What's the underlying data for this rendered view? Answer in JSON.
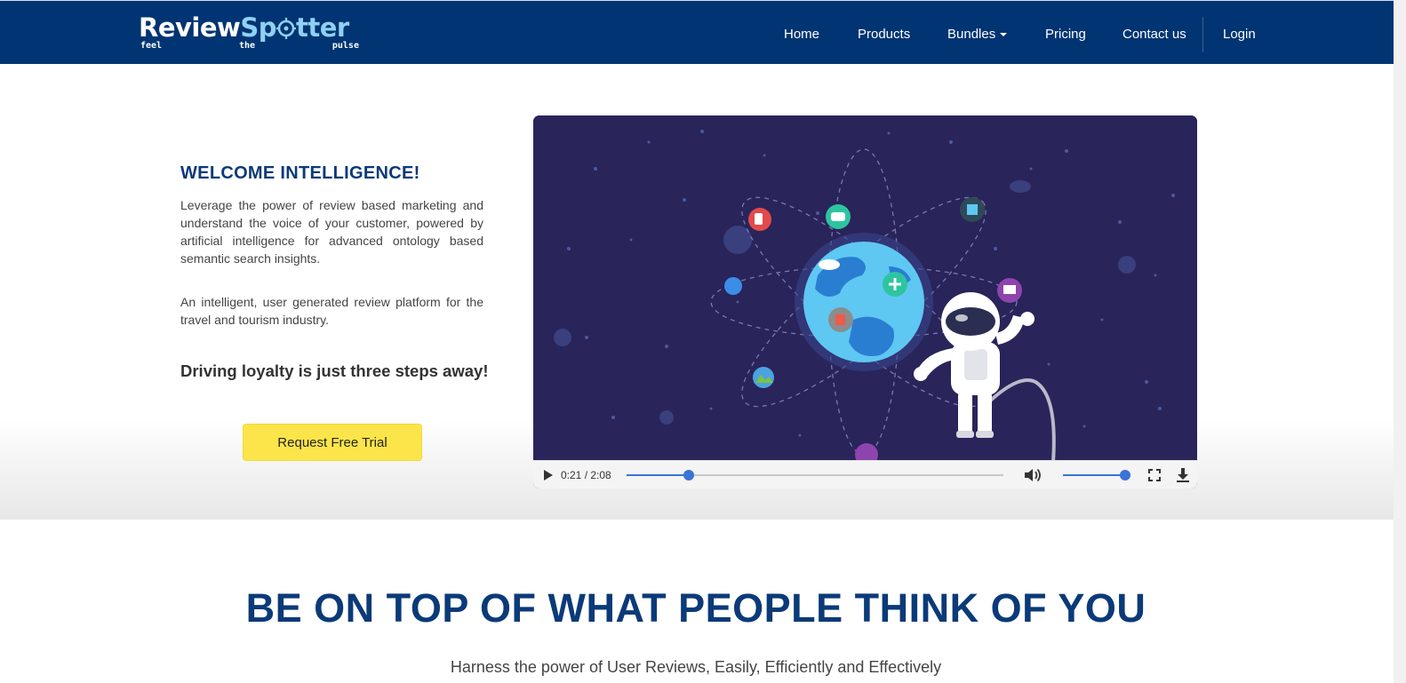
{
  "brand": {
    "name_part1": "Review",
    "name_part2": "Sp",
    "name_part3": "tter",
    "tagline_words": [
      "feel",
      "the",
      "pulse"
    ],
    "colors": {
      "navy": "#003472",
      "accent": "#8fd1f2",
      "cta": "#fce54a",
      "heading": "#0b3a78"
    }
  },
  "nav": {
    "items": [
      {
        "label": "Home"
      },
      {
        "label": "Products"
      },
      {
        "label": "Bundles"
      },
      {
        "label": "Pricing"
      },
      {
        "label": "Contact us"
      },
      {
        "label": "Login"
      }
    ]
  },
  "hero": {
    "title": "WELCOME INTELLIGENCE!",
    "paragraph1": "Leverage the power of review based marketing and understand the voice of your customer, powered by artificial intelligence for advanced ontology based semantic search insights.",
    "paragraph2": "An intelligent, user generated review platform for the travel and tourism industry.",
    "tagline": "Driving loyalty is just three steps away!",
    "cta_label": "Request Free Trial"
  },
  "video": {
    "time_display": "0:21 / 2:08",
    "progress": 0.164,
    "volume": 1.0,
    "icons": [
      "play-icon",
      "volume-icon",
      "fullscreen-icon",
      "download-icon"
    ]
  },
  "section": {
    "title": "BE ON TOP OF WHAT PEOPLE THINK OF YOU",
    "subtitle": "Harness the power of User Reviews, Easily, Efficiently and Effectively"
  }
}
